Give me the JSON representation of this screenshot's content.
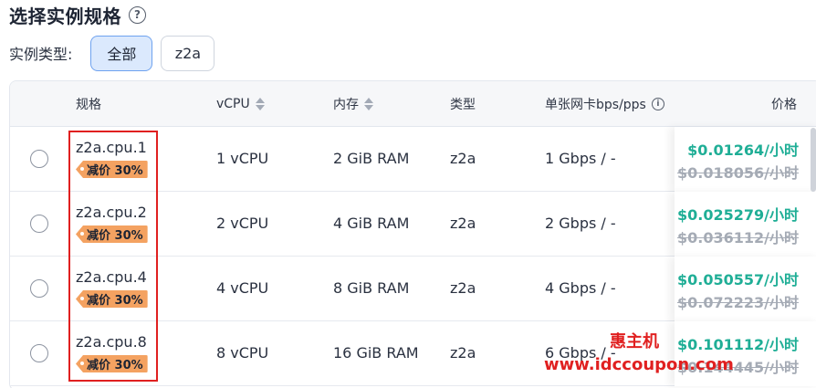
{
  "header": {
    "title": "选择实例规格",
    "help_icon": "question-circle-icon"
  },
  "filter": {
    "label": "实例类型:",
    "options": [
      "全部",
      "z2a"
    ],
    "selected": "全部"
  },
  "table": {
    "columns": {
      "spec": "规格",
      "vcpu": "vCPU",
      "memory": "内存",
      "type": "类型",
      "network": "单张网卡bps/pps",
      "price": "价格"
    },
    "rows": [
      {
        "spec": "z2a.cpu.1",
        "discount": "减价 30%",
        "vcpu": "1 vCPU",
        "memory": "2 GiB RAM",
        "type": "z2a",
        "network": "1 Gbps / -",
        "price_now": "$0.01264/小时",
        "price_old": "$0.018056/小时"
      },
      {
        "spec": "z2a.cpu.2",
        "discount": "减价 30%",
        "vcpu": "2 vCPU",
        "memory": "4 GiB RAM",
        "type": "z2a",
        "network": "2 Gbps / -",
        "price_now": "$0.025279/小时",
        "price_old": "$0.036112/小时"
      },
      {
        "spec": "z2a.cpu.4",
        "discount": "减价 30%",
        "vcpu": "4 vCPU",
        "memory": "8 GiB RAM",
        "type": "z2a",
        "network": "4 Gbps / -",
        "price_now": "$0.050557/小时",
        "price_old": "$0.072223/小时"
      },
      {
        "spec": "z2a.cpu.8",
        "discount": "减价 30%",
        "vcpu": "8 vCPU",
        "memory": "16 GiB RAM",
        "type": "z2a",
        "network": "6 Gbps / -",
        "price_now": "$0.101112/小时",
        "price_old": "$0.144445/小时"
      }
    ]
  },
  "watermark": {
    "line1": "惠主机",
    "line2": "www.idccoupon.com"
  },
  "colors": {
    "accent": "#6ea2ef",
    "price": "#1fae96",
    "discount_tag": "#f4a261",
    "highlight": "#e02020"
  }
}
